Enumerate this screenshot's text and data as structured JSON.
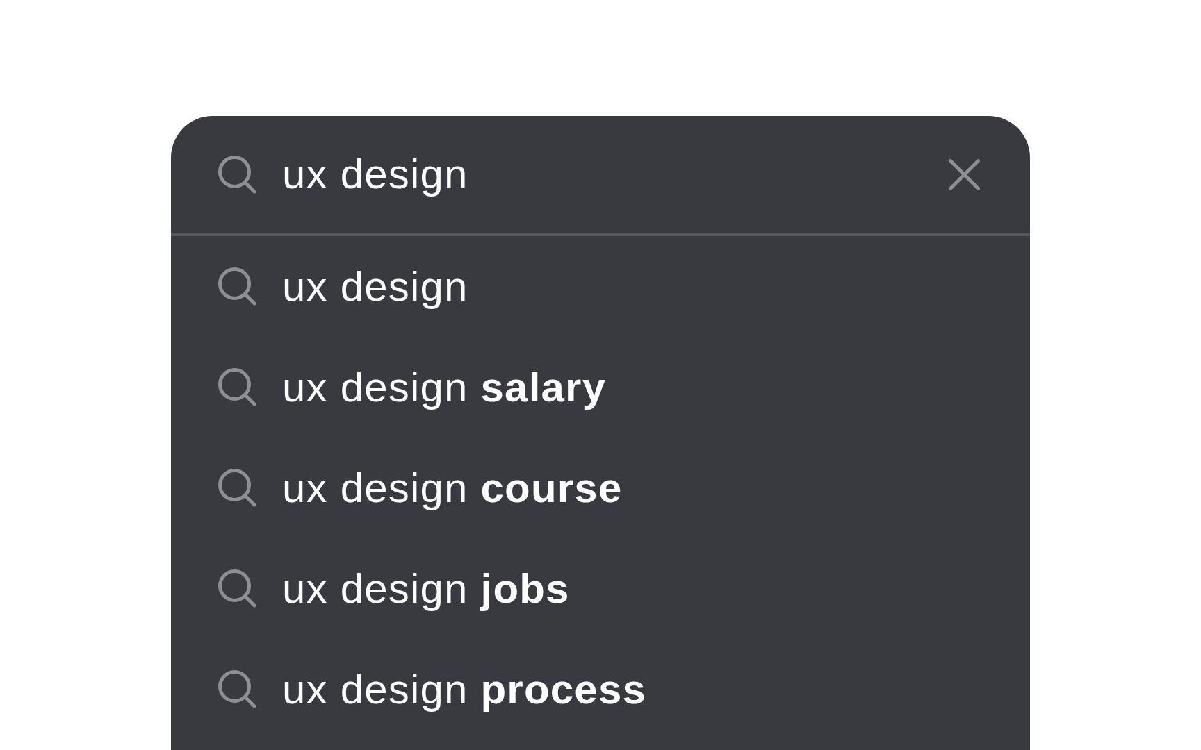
{
  "search_bar": {
    "value": "ux design"
  },
  "suggestions": [
    {
      "text": "ux design"
    },
    {
      "text": "ux design **salary**"
    },
    {
      "text": "ux design **course**"
    },
    {
      "text": "ux design **jobs**"
    },
    {
      "text": "ux design **process**"
    }
  ]
}
